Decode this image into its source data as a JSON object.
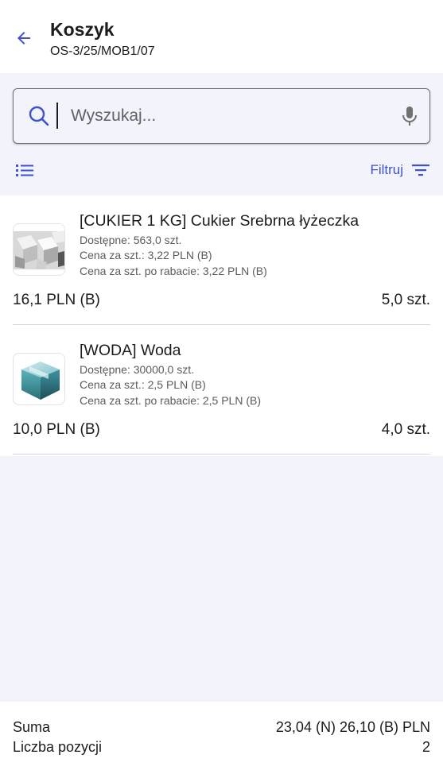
{
  "header": {
    "title": "Koszyk",
    "subtitle": "OS-3/25/MOB1/07"
  },
  "search": {
    "placeholder": "Wyszukaj...",
    "value": ""
  },
  "toolbar": {
    "filter_label": "Filtruj"
  },
  "items": [
    {
      "name": "[CUKIER 1 KG] Cukier Srebrna łyżeczka",
      "available": "Dostępne: 563,0 szt.",
      "price": "Cena za szt.: 3,22 PLN (B)",
      "price_discount": "Cena za szt. po rabacie: 3,22 PLN (B)",
      "total": "16,1 PLN (B)",
      "quantity": "5,0 szt.",
      "thumb_icon": "sugar-cubes-image"
    },
    {
      "name": "[WODA] Woda",
      "available": "Dostępne: 30000,0 szt.",
      "price": "Cena za szt.: 2,5 PLN (B)",
      "price_discount": "Cena za szt. po rabacie: 2,5 PLN (B)",
      "total": "10,0 PLN (B)",
      "quantity": "4,0 szt.",
      "thumb_icon": "box-image"
    }
  ],
  "footer": {
    "sum_label": "Suma",
    "sum_value": "23,04 (N) 26,10 (B) PLN",
    "count_label": "Liczba pozycji",
    "count_value": "2"
  },
  "colors": {
    "accent": "#3f51d0",
    "background": "#f3f4fb",
    "surface": "#ffffff"
  }
}
